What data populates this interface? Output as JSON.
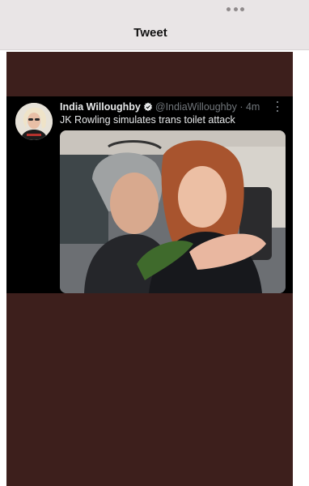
{
  "header": {
    "title": "Tweet",
    "more_icon": "more-horizontal-icon"
  },
  "tweet": {
    "author_name": "India Willoughby",
    "verified_icon": "verified-badge-icon",
    "handle": "@IndiaWilloughby",
    "separator": "·",
    "time": "4m",
    "text": "JK Rowling simulates trans toilet attack",
    "more_icon": "more-vertical-icon",
    "media_description_icon": "photo-image"
  },
  "colors": {
    "background": "#3d1f1c",
    "header": "#e9e5e6",
    "tweet_bg": "#000000",
    "name": "#e7e9ea",
    "meta": "#71767b",
    "verified": "#1d9bf0"
  }
}
